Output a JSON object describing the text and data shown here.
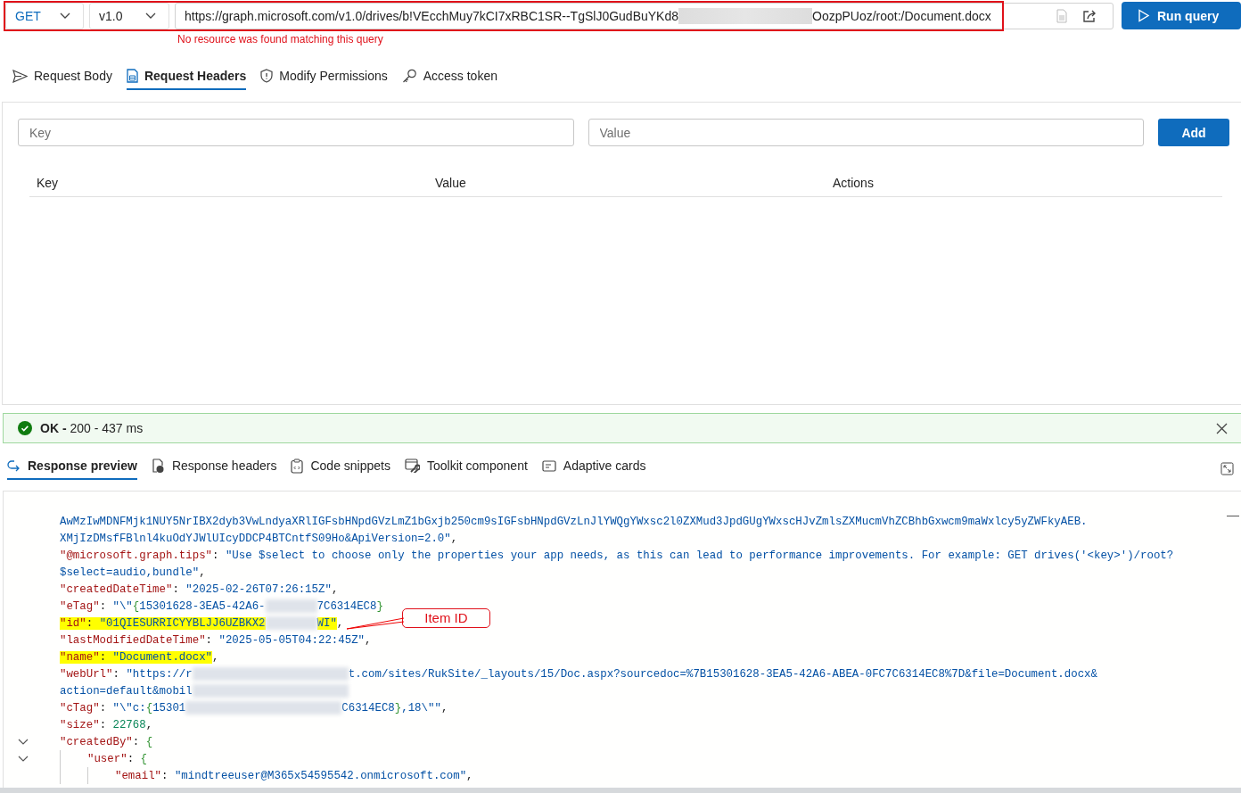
{
  "query_bar": {
    "method": "GET",
    "version": "v1.0",
    "url_start": "https://graph.microsoft.com/v1.0/drives/b!VEcchMuy7kCI7xRBC1SR--TgSlJ0GudBuYKd8",
    "url_end": "OozpPUoz/root:/Document.docx",
    "run_button": "Run query",
    "error": "No resource was found matching this query"
  },
  "request_tabs": [
    {
      "label": "Request Body",
      "selected": false
    },
    {
      "label": "Request Headers",
      "selected": true
    },
    {
      "label": "Modify Permissions",
      "selected": false
    },
    {
      "label": "Access token",
      "selected": false
    }
  ],
  "headers_form": {
    "key_placeholder": "Key",
    "value_placeholder": "Value",
    "add_button": "Add",
    "columns": [
      "Key",
      "Value",
      "Actions"
    ]
  },
  "status": {
    "label": "OK -",
    "detail": "200 - 437 ms"
  },
  "response_tabs": [
    {
      "label": "Response preview",
      "selected": true
    },
    {
      "label": "Response headers",
      "selected": false
    },
    {
      "label": "Code snippets",
      "selected": false
    },
    {
      "label": "Toolkit component",
      "selected": false
    },
    {
      "label": "Adaptive cards",
      "selected": false
    }
  ],
  "code_lines": [
    {
      "highlighted": false,
      "fold": false,
      "segments": [
        {
          "kind": "str",
          "t": "AwMzIwMDNFMjk1NUY5NrIBX2dyb3VwLndyaXRlIGFsbHNpdGVzLmZ1bGxjb250cm9sIGFsbHNpdGVzLnJlYWQgYWxsc2l0ZXMud3JpdGUgYWxscHJvZmlsZXMucmVhZCBhbGxwcm9maWxlcy5yZWFkyAEB."
        }
      ]
    },
    {
      "highlighted": false,
      "fold": false,
      "segments": [
        {
          "kind": "str",
          "t": "XMjIzDMsfFBlnl4kuOdYJWlUIcyDDCP4BTCntfS09Ho&ApiVersion=2.0\""
        },
        {
          "kind": "punct",
          "t": ","
        }
      ]
    },
    {
      "highlighted": false,
      "fold": false,
      "segments": [
        {
          "kind": "key",
          "t": "\"@microsoft.graph.tips\""
        },
        {
          "kind": "sep",
          "t": ": "
        },
        {
          "kind": "str",
          "t": "\"Use $select to choose only the properties your app needs, as this can lead to performance improvements. For example: GET drives('<key>')/root?"
        }
      ]
    },
    {
      "highlighted": false,
      "fold": false,
      "segments": [
        {
          "kind": "str",
          "t": "$select=audio,bundle\""
        },
        {
          "kind": "punct",
          "t": ","
        }
      ]
    },
    {
      "highlighted": false,
      "fold": false,
      "segments": [
        {
          "kind": "key",
          "t": "\"createdDateTime\""
        },
        {
          "kind": "sep",
          "t": ": "
        },
        {
          "kind": "str",
          "t": "\"2025-02-26T07:26:15Z\""
        },
        {
          "kind": "punct",
          "t": ","
        }
      ]
    },
    {
      "highlighted": false,
      "fold": false,
      "segments": [
        {
          "kind": "key",
          "t": "\"eTag\""
        },
        {
          "kind": "sep",
          "t": ": "
        },
        {
          "kind": "str",
          "t": "\"\\\""
        },
        {
          "kind": "brace",
          "t": "{"
        },
        {
          "kind": "str",
          "t": "15301628-3EA5-42A6-"
        },
        {
          "kind": "redacted"
        },
        {
          "kind": "str",
          "t": "7C6314EC8"
        },
        {
          "kind": "brace",
          "t": "}"
        }
      ]
    },
    {
      "highlighted": true,
      "fold": false,
      "callout": "Item ID",
      "segments": [
        {
          "kind": "key",
          "t": "\"id\""
        },
        {
          "kind": "sep",
          "t": ": "
        },
        {
          "kind": "str",
          "t": "\"01QIESURRICYYBLJJ6UZBKX2"
        },
        {
          "kind": "redacted"
        },
        {
          "kind": "str",
          "t": "WI\""
        },
        {
          "kind": "punct",
          "t": ","
        }
      ]
    },
    {
      "highlighted": false,
      "fold": false,
      "segments": [
        {
          "kind": "key",
          "t": "\"lastModifiedDateTime\""
        },
        {
          "kind": "sep",
          "t": ": "
        },
        {
          "kind": "str",
          "t": "\"2025-05-05T04:22:45Z\""
        },
        {
          "kind": "punct",
          "t": ","
        }
      ]
    },
    {
      "highlighted": true,
      "fold": false,
      "segments": [
        {
          "kind": "key",
          "t": "\"name\""
        },
        {
          "kind": "sep",
          "t": ": "
        },
        {
          "kind": "str",
          "t": "\"Document.docx\""
        },
        {
          "kind": "punct",
          "t": ","
        }
      ]
    },
    {
      "highlighted": false,
      "fold": false,
      "segments": [
        {
          "kind": "key",
          "t": "\"webUrl\""
        },
        {
          "kind": "sep",
          "t": ": "
        },
        {
          "kind": "str",
          "t": "\"https://r"
        },
        {
          "kind": "redacted_long"
        },
        {
          "kind": "str",
          "t": "t.com/sites/RukSite/_layouts/15/Doc.aspx?sourcedoc=%7B15301628-3EA5-42A6-ABEA-0FC7C6314EC8%7D&file=Document.docx&"
        }
      ]
    },
    {
      "highlighted": false,
      "fold": false,
      "segments": [
        {
          "kind": "str",
          "t": "action=default&mobil"
        },
        {
          "kind": "redacted_long"
        }
      ]
    },
    {
      "highlighted": false,
      "fold": false,
      "segments": [
        {
          "kind": "key",
          "t": "\"cTag\""
        },
        {
          "kind": "sep",
          "t": ": "
        },
        {
          "kind": "str",
          "t": "\"\\\"c:"
        },
        {
          "kind": "brace",
          "t": "{"
        },
        {
          "kind": "str",
          "t": "15301"
        },
        {
          "kind": "redacted_long"
        },
        {
          "kind": "str",
          "t": "C6314EC8"
        },
        {
          "kind": "brace",
          "t": "}"
        },
        {
          "kind": "str",
          "t": ",18\\\"\""
        },
        {
          "kind": "punct",
          "t": ","
        }
      ]
    },
    {
      "highlighted": false,
      "fold": false,
      "segments": [
        {
          "kind": "key",
          "t": "\"size\""
        },
        {
          "kind": "sep",
          "t": ": "
        },
        {
          "kind": "num",
          "t": "22768"
        },
        {
          "kind": "punct",
          "t": ","
        }
      ]
    },
    {
      "highlighted": false,
      "fold": true,
      "segments": [
        {
          "kind": "key",
          "t": "\"createdBy\""
        },
        {
          "kind": "sep",
          "t": ": "
        },
        {
          "kind": "brace",
          "t": "{"
        }
      ],
      "children": [
        {
          "highlighted": false,
          "fold": true,
          "segments": [
            {
              "kind": "key",
              "t": "\"user\""
            },
            {
              "kind": "sep",
              "t": ": "
            },
            {
              "kind": "brace",
              "t": "{"
            }
          ],
          "children": [
            {
              "highlighted": false,
              "fold": false,
              "segments": [
                {
                  "kind": "key",
                  "t": "\"email\""
                },
                {
                  "kind": "sep",
                  "t": ": "
                },
                {
                  "kind": "str",
                  "t": "\"mindtreeuser@M365x54595542.onmicrosoft.com\""
                },
                {
                  "kind": "punct",
                  "t": ","
                }
              ]
            }
          ]
        }
      ]
    }
  ]
}
